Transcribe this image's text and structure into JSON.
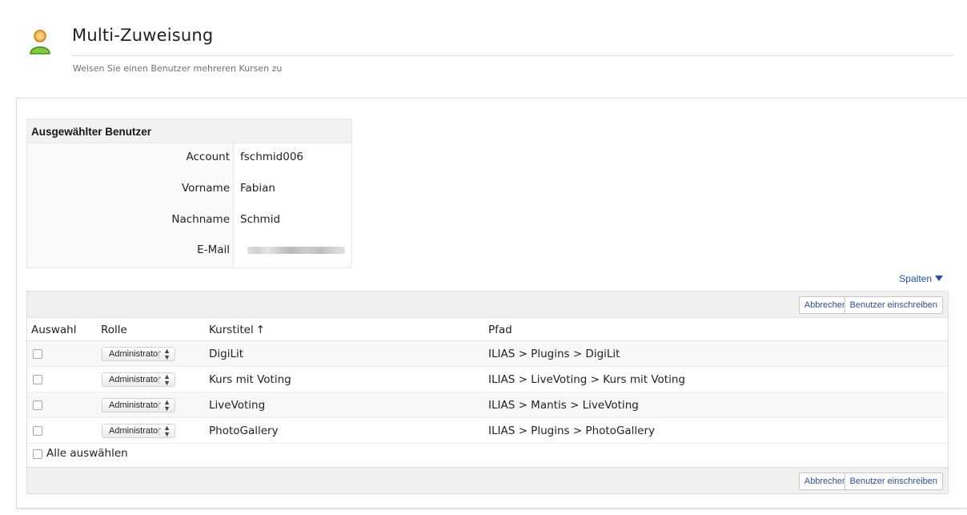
{
  "header": {
    "title": "Multi-Zuweisung",
    "subtitle": "Weisen Sie einen Benutzer mehreren Kursen zu",
    "icon": "user-icon"
  },
  "user_info": {
    "heading": "Ausgewählter Benutzer",
    "fields": [
      {
        "label": "Account",
        "value": "fschmid006"
      },
      {
        "label": "Vorname",
        "value": "Fabian"
      },
      {
        "label": "Nachname",
        "value": "Schmid"
      },
      {
        "label": "E-Mail",
        "value": ""
      }
    ]
  },
  "table": {
    "columns_toggle": "Spalten",
    "buttons": {
      "cancel": "Abbrechen",
      "enroll": "Benutzer einschreiben"
    },
    "headers": {
      "select": "Auswahl",
      "role": "Rolle",
      "title": "Kurstitel",
      "path": "Pfad"
    },
    "sort_arrow": "↑",
    "rows": [
      {
        "role": "Administrator",
        "title": "DigiLit",
        "path": "ILIAS > Plugins > DigiLit"
      },
      {
        "role": "Administrator",
        "title": "Kurs mit Voting",
        "path": "ILIAS > LiveVoting > Kurs mit Voting"
      },
      {
        "role": "Administrator",
        "title": "LiveVoting",
        "path": "ILIAS > Mantis > LiveVoting"
      },
      {
        "role": "Administrator",
        "title": "PhotoGallery",
        "path": "ILIAS > Plugins > PhotoGallery"
      }
    ],
    "select_all": "Alle auswählen"
  },
  "colors": {
    "link": "#2255a4",
    "header_bg": "#f0f0f0",
    "icon_green": "#5cbf2a",
    "icon_orange": "#f2a33a"
  }
}
